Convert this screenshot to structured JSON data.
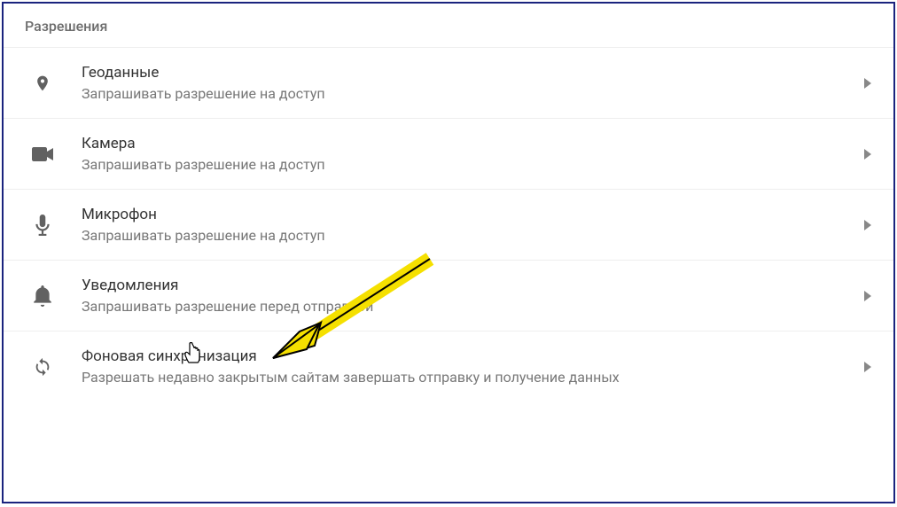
{
  "section_title": "Разрешения",
  "items": [
    {
      "id": "location",
      "title": "Геоданные",
      "subtitle": "Запрашивать разрешение на доступ"
    },
    {
      "id": "camera",
      "title": "Камера",
      "subtitle": "Запрашивать разрешение на доступ"
    },
    {
      "id": "microphone",
      "title": "Микрофон",
      "subtitle": "Запрашивать разрешение на доступ"
    },
    {
      "id": "notifications",
      "title": "Уведомления",
      "subtitle": "Запрашивать разрешение перед отправкой"
    },
    {
      "id": "background-sync",
      "title": "Фоновая синхронизация",
      "subtitle": "Разрешать недавно закрытым сайтам завершать отправку и получение данных"
    }
  ]
}
